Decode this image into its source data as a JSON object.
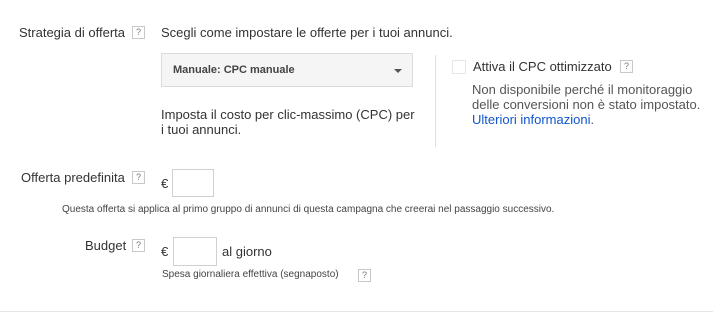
{
  "bid_strategy": {
    "label": "Strategia di offerta",
    "help": "?",
    "description": "Scegli come impostare le offerte per i tuoi annunci.",
    "select_value": "Manuale: CPC manuale",
    "select_note_line1": "Imposta il costo per clic-massimo (CPC) per",
    "select_note_line2": "i tuoi annunci."
  },
  "ecpc": {
    "label": "Attiva il CPC ottimizzato",
    "help": "?",
    "note_line1": "Non disponibile perché il monitoraggio",
    "note_line2": "delle conversioni non è stato impostato.",
    "link": "Ulteriori informazioni",
    "link_suffix": "."
  },
  "default_bid": {
    "label": "Offerta predefinita",
    "help": "?",
    "currency": "€",
    "value": "",
    "hint": "Questa offerta si applica al primo gruppo di annunci di questa campagna che creerai nel passaggio successivo."
  },
  "budget": {
    "label": "Budget",
    "help": "?",
    "currency": "€",
    "value": "",
    "per_day": "al giorno",
    "hint": "Spesa giornaliera effettiva (segnaposto)",
    "hint_help": "?"
  }
}
